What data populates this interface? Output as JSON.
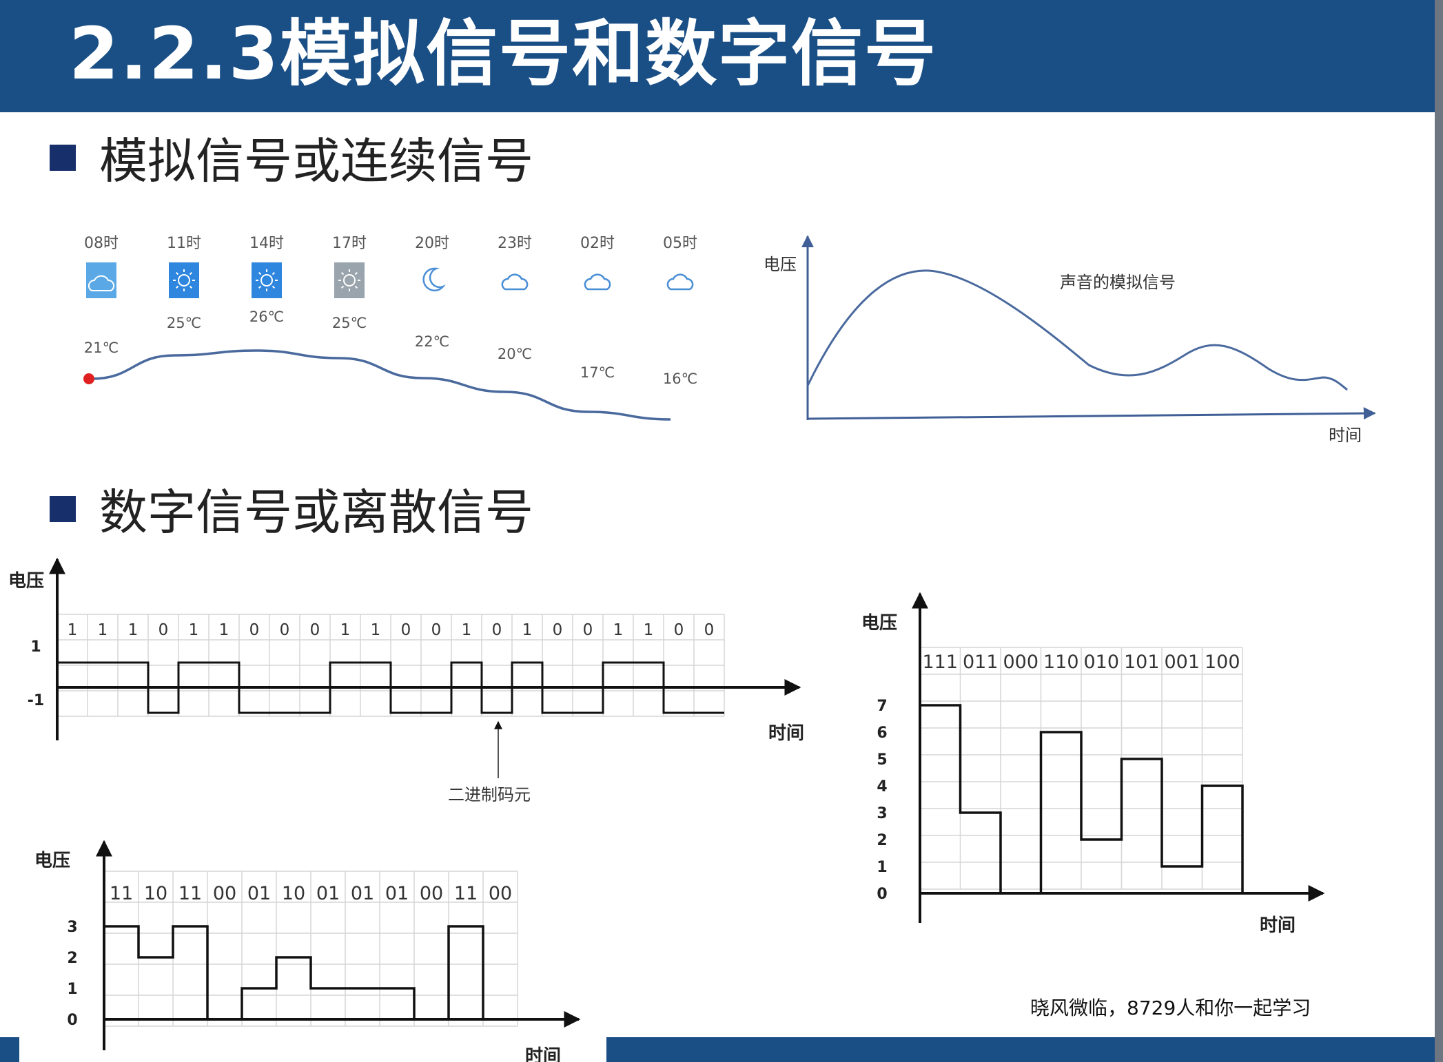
{
  "slide": {
    "title": "2.2.3模拟信号和数字信号",
    "section_analog": "模拟信号或连续信号",
    "section_digital": "数字信号或离散信号",
    "watermark": "晓风微临，8729人和你一起学习"
  },
  "weather": {
    "hours": [
      "08时",
      "11时",
      "14时",
      "17时",
      "20时",
      "23时",
      "02时",
      "05时"
    ],
    "icons": [
      "cloudy-day-icon",
      "sun-icon",
      "sun-icon",
      "sun-icon-gray",
      "moon-icon",
      "cloudy-night-icon",
      "cloudy-night-icon",
      "cloudy-night-icon"
    ],
    "temps_label": [
      "21℃",
      "25℃",
      "26℃",
      "25℃",
      "22℃",
      "20℃",
      "17℃",
      "16℃"
    ],
    "temps": [
      21,
      25,
      26,
      25,
      22,
      20,
      17,
      16
    ]
  },
  "analog_chart": {
    "ylabel": "电压",
    "xlabel": "时间",
    "annotation": "声音的模拟信号"
  },
  "chart_data": [
    {
      "type": "line",
      "title": "",
      "x": [
        "08时",
        "11时",
        "14时",
        "17时",
        "20时",
        "23时",
        "02时",
        "05时"
      ],
      "series": [
        {
          "values": [
            21,
            25,
            26,
            25,
            22,
            20,
            17,
            16
          ]
        }
      ]
    },
    {
      "type": "line",
      "xlabel": "时间",
      "ylabel": "电压",
      "annotation": "声音的模拟信号"
    },
    {
      "type": "line",
      "ylabel": "电压",
      "xlabel": "时间",
      "yticks": [
        "1",
        "-1"
      ],
      "bits": [
        "1",
        "1",
        "1",
        "0",
        "1",
        "1",
        "0",
        "0",
        "0",
        "1",
        "1",
        "0",
        "0",
        "1",
        "0",
        "1",
        "0",
        "0",
        "1",
        "1",
        "0",
        "0"
      ],
      "annotation": "二进制码元"
    },
    {
      "type": "line",
      "ylabel": "电压",
      "xlabel": "时间",
      "yticks": [
        "0",
        "1",
        "2",
        "3"
      ],
      "symbols": [
        "11",
        "10",
        "11",
        "00",
        "01",
        "10",
        "01",
        "01",
        "01",
        "00",
        "11",
        "00"
      ],
      "values": [
        3,
        2,
        3,
        0,
        1,
        2,
        1,
        1,
        1,
        0,
        3,
        0
      ]
    },
    {
      "type": "line",
      "ylabel": "电压",
      "xlabel": "时间",
      "yticks": [
        "0",
        "1",
        "2",
        "3",
        "4",
        "5",
        "6",
        "7"
      ],
      "symbols": [
        "111",
        "011",
        "000",
        "110",
        "010",
        "101",
        "001",
        "100"
      ],
      "values": [
        7,
        3,
        0,
        6,
        2,
        5,
        1,
        4
      ]
    }
  ],
  "colors": {
    "title_bar": "#1a4f86",
    "bullet": "#17306b",
    "curve": "#4a6a9e",
    "sun_tile": "#2e86de",
    "dot": "#e02020"
  }
}
